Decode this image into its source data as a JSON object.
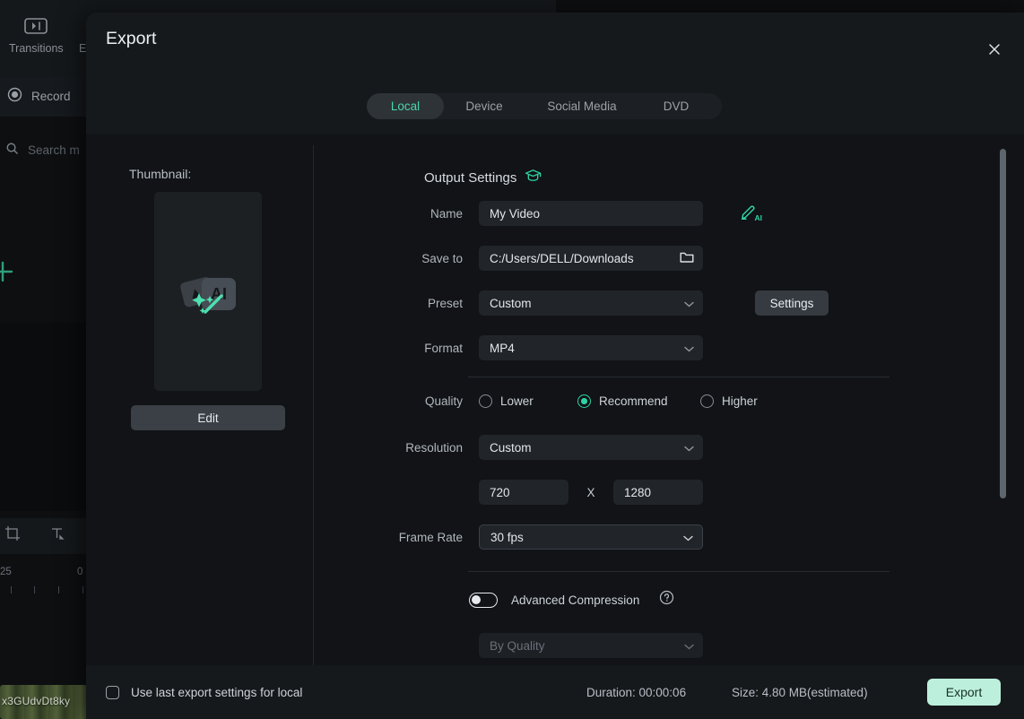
{
  "background": {
    "tools": [
      {
        "label": "Transitions",
        "icon": "transitions-icon"
      },
      {
        "label": "E",
        "icon": "effects-icon"
      }
    ],
    "record_label": "Record",
    "search_placeholder": "Search m",
    "ruler_ticks": [
      "25",
      "0"
    ],
    "clip_label": "x3GUdvDt8ky"
  },
  "dialog": {
    "title": "Export",
    "close_icon": "close-icon",
    "tabs": [
      {
        "label": "Local",
        "active": true
      },
      {
        "label": "Device",
        "active": false
      },
      {
        "label": "Social Media",
        "active": false
      },
      {
        "label": "DVD",
        "active": false
      }
    ],
    "thumbnail": {
      "label": "Thumbnail:",
      "placeholder_icon": "ai-thumbnail-placeholder-icon",
      "edit_label": "Edit"
    },
    "output_settings": {
      "heading": "Output Settings",
      "heading_icon": "graduation-cap-icon",
      "name": {
        "label": "Name",
        "value": "My Video",
        "ai_icon": "ai-pen-icon"
      },
      "save_to": {
        "label": "Save to",
        "value": "C:/Users/DELL/Downloads",
        "folder_icon": "folder-icon"
      },
      "preset": {
        "label": "Preset",
        "value": "Custom",
        "button_label": "Settings"
      },
      "format": {
        "label": "Format",
        "value": "MP4"
      },
      "quality": {
        "label": "Quality",
        "options": [
          {
            "label": "Lower",
            "selected": false
          },
          {
            "label": "Recommend",
            "selected": true
          },
          {
            "label": "Higher",
            "selected": false
          }
        ]
      },
      "resolution": {
        "label": "Resolution",
        "value": "Custom",
        "width": "720",
        "separator": "X",
        "height": "1280"
      },
      "frame_rate": {
        "label": "Frame Rate",
        "value": "30 fps"
      },
      "advanced_compression": {
        "label": "Advanced Compression",
        "enabled": false,
        "help_icon": "help-icon",
        "mode_value": "By Quality"
      }
    },
    "footer": {
      "use_last_settings_label": "Use last export settings for local",
      "use_last_settings_checked": false,
      "duration": "Duration: 00:00:06",
      "size": "Size: 4.80 MB(estimated)",
      "export_label": "Export"
    }
  },
  "colors": {
    "accent_green": "#2fd3a5",
    "export_button": "#bdf0dc",
    "dialog_bg": "#16191c",
    "body_bg": "#111316"
  }
}
